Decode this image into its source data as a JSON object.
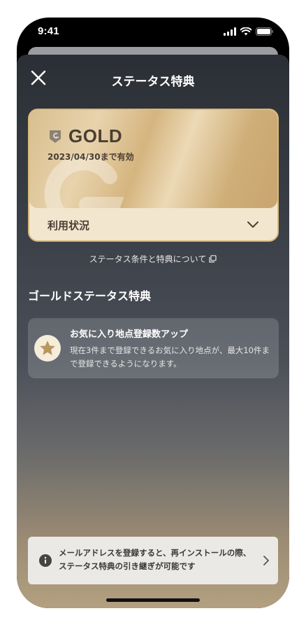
{
  "status_bar": {
    "time": "9:41"
  },
  "sheet": {
    "title": "ステータス特典",
    "close_icon": "close-icon"
  },
  "card": {
    "tier": "GOLD",
    "validity": "2023/04/30まで有効",
    "usage_label": "利用状況",
    "colors": {
      "gold_light": "#ecd9b6",
      "gold_dark": "#c9a570",
      "text": "#4a3f33"
    }
  },
  "terms_link": {
    "label": "ステータス条件と特典について",
    "icon": "external-link-icon"
  },
  "section": {
    "title": "ゴールドステータス特典"
  },
  "benefits": [
    {
      "icon": "star-icon",
      "title": "お気に入り地点登録数アップ",
      "description": "現在3件まで登録できるお気に入り地点が、最大10件まで登録できるようになります。"
    }
  ],
  "info_banner": {
    "icon": "info-icon",
    "text": "メールアドレスを登録すると、再インストールの際、ステータス特典の引き継ぎが可能です"
  }
}
